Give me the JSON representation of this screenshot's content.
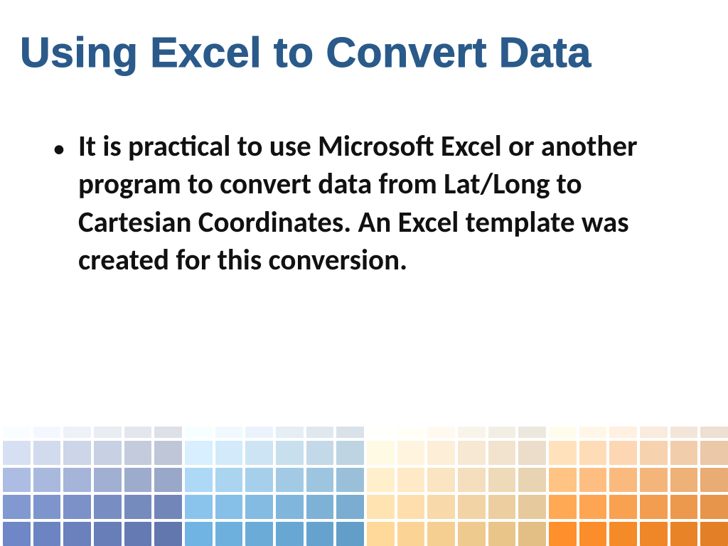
{
  "title": "Using Excel to Convert Data",
  "bullets": [
    "It is practical to use Microsoft Excel or another program to convert data from Lat/Long to Cartesian Coordinates. An Excel template  was created for this conversion."
  ],
  "footer_grid": {
    "rows": 5,
    "cols": 24,
    "palette_left": [
      "#eef1f8",
      "#cfd7ea",
      "#a8b7dc",
      "#7f95cd",
      "#6e86c4"
    ],
    "palette_mid1": [
      "#eaf3fb",
      "#cfe6f6",
      "#a9d3ef",
      "#87c0e8",
      "#6fb2e1"
    ],
    "palette_mid2": [
      "#fff9ef",
      "#fff0da",
      "#ffe8c5",
      "#ffdfae",
      "#ffd797"
    ],
    "palette_right": [
      "#fff0e2",
      "#ffd9b5",
      "#ffbd80",
      "#ffa653",
      "#ff8f2b"
    ]
  }
}
